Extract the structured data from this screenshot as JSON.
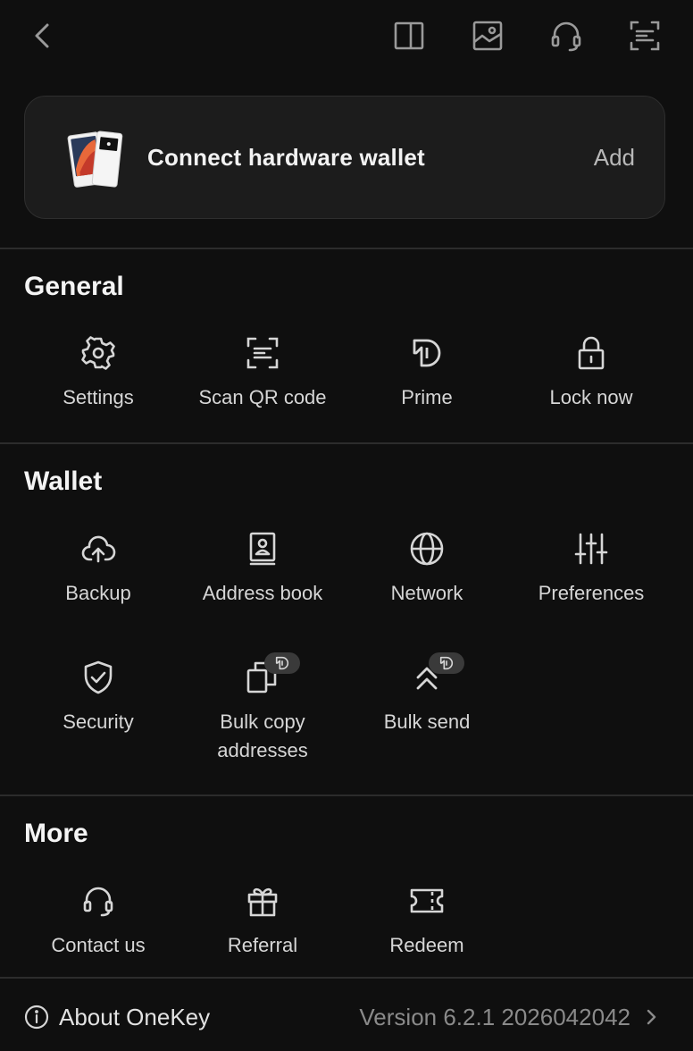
{
  "topbar": {
    "back_icon": "chevron-left-icon",
    "icons": [
      "sidebar-layout-icon",
      "image-gallery-icon",
      "headset-icon",
      "scan-icon"
    ]
  },
  "hardware_card": {
    "title": "Connect hardware wallet",
    "action": "Add"
  },
  "sections": {
    "general": {
      "title": "General",
      "items": [
        {
          "label": "Settings",
          "icon": "gear-icon"
        },
        {
          "label": "Scan QR code",
          "icon": "scan-icon"
        },
        {
          "label": "Prime",
          "icon": "prime-icon"
        },
        {
          "label": "Lock now",
          "icon": "lock-icon"
        }
      ]
    },
    "wallet": {
      "title": "Wallet",
      "items": [
        {
          "label": "Backup",
          "icon": "cloud-upload-icon"
        },
        {
          "label": "Address book",
          "icon": "contact-book-icon"
        },
        {
          "label": "Network",
          "icon": "globe-icon"
        },
        {
          "label": "Preferences",
          "icon": "sliders-icon"
        },
        {
          "label": "Security",
          "icon": "shield-check-icon"
        },
        {
          "label": "Bulk copy addresses",
          "icon": "copy-icon",
          "badge": "prime"
        },
        {
          "label": "Bulk send",
          "icon": "double-chevron-up-icon",
          "badge": "prime"
        }
      ]
    },
    "more": {
      "title": "More",
      "items": [
        {
          "label": "Contact us",
          "icon": "headset-icon"
        },
        {
          "label": "Referral",
          "icon": "gift-icon"
        },
        {
          "label": "Redeem",
          "icon": "ticket-icon"
        }
      ]
    }
  },
  "about": {
    "label": "About OneKey",
    "version": "Version 6.2.1 2026042042"
  },
  "colors": {
    "background": "#0f0f0f",
    "card": "#1c1c1c",
    "divider": "#2c2c2c",
    "text": "#e6e6e6",
    "muted": "#8a8a8a"
  }
}
